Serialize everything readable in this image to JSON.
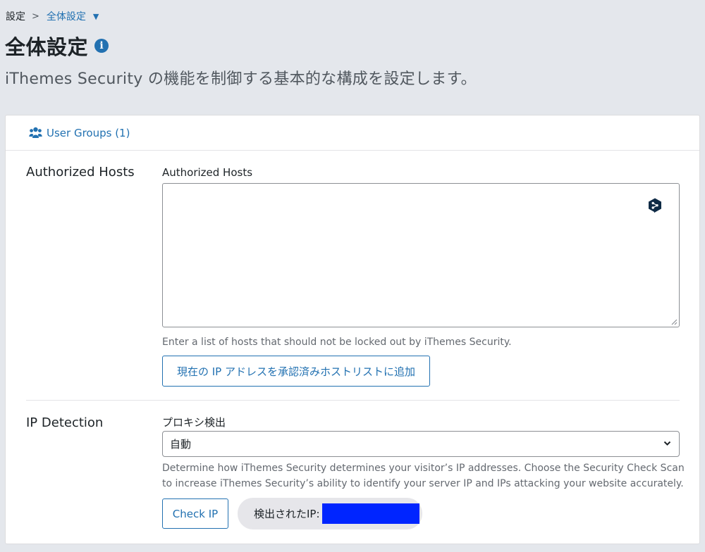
{
  "breadcrumb": {
    "root": "設定",
    "separator": ">",
    "current": "全体設定",
    "caret": "▼"
  },
  "page": {
    "title": "全体設定",
    "info_glyph": "i",
    "description": "iThemes Security の機能を制御する基本的な構成を設定します。"
  },
  "card": {
    "user_groups_label": "User Groups (1)",
    "authorized_hosts": {
      "section_label": "Authorized Hosts",
      "field_label": "Authorized Hosts",
      "textarea_value": "",
      "help": "Enter a list of hosts that should not be locked out by iThemes Security.",
      "add_button": "現在の IP アドレスを承認済みホストリストに追加"
    },
    "ip_detection": {
      "section_label": "IP Detection",
      "field_label": "プロキシ検出",
      "selected_value": "自動",
      "help_line1": "Determine how iThemes Security determines your visitor’s IP addresses. Choose the Security Check Scan",
      "help_line2": "to increase iThemes Security’s ability to identify your server IP and IPs attacking your website accurately.",
      "check_button": "Check IP",
      "detected_label": "検出されたIP:"
    }
  },
  "colors": {
    "accent": "#2271b1",
    "redaction": "#0025ff",
    "background": "#e4e7ec"
  },
  "icons": {
    "info": "info-icon",
    "user_groups": "users-icon",
    "textarea_tool": "deepl-icon",
    "select": "chevron-down-icon"
  }
}
